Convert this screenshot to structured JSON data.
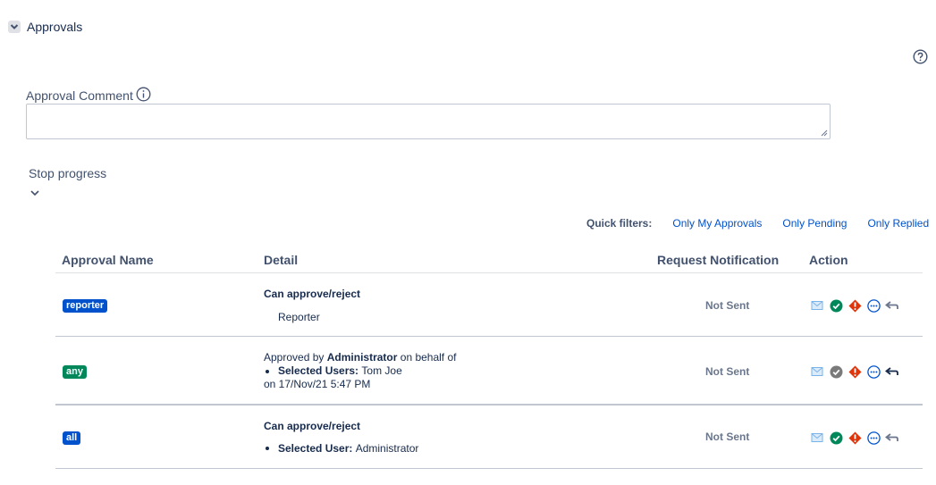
{
  "section": {
    "title": "Approvals"
  },
  "comment": {
    "label": "Approval Comment",
    "value": "",
    "placeholder": ""
  },
  "stop_progress": {
    "label": "Stop progress"
  },
  "quick_filters": {
    "label": "Quick filters:",
    "links": [
      "Only My Approvals",
      "Only Pending",
      "Only Replied"
    ]
  },
  "table": {
    "headers": [
      "Approval Name",
      "Detail",
      "Request Notification",
      "Action"
    ],
    "rows": [
      {
        "name": "reporter",
        "detail_title": "Can approve/reject",
        "detail_sub": "Reporter",
        "notification": "Not Sent"
      },
      {
        "name": "any",
        "line1_pre": "Approved by",
        "line1_bold": "Administrator",
        "line1_post": "on behalf of",
        "bullet_label": "Selected Users:",
        "bullet_value": "Tom Joe",
        "line3": "on 17/Nov/21 5:47 PM",
        "notification": "Not Sent"
      },
      {
        "name": "all",
        "detail_title": "Can approve/reject",
        "bullet_label": "Selected User:",
        "bullet_value": "Administrator",
        "notification": "Not Sent"
      }
    ]
  },
  "colors": {
    "link": "#0052cc",
    "lozenge_blue": "#0052cc",
    "lozenge_green": "#00875a",
    "approve_green": "#00875a",
    "reject_red": "#de350b",
    "more_blue": "#0052cc"
  },
  "icons": [
    "chevron-down-icon",
    "help-icon",
    "info-icon",
    "mail-icon",
    "approve-icon",
    "reject-icon",
    "more-icon",
    "back-arrow-icon"
  ]
}
